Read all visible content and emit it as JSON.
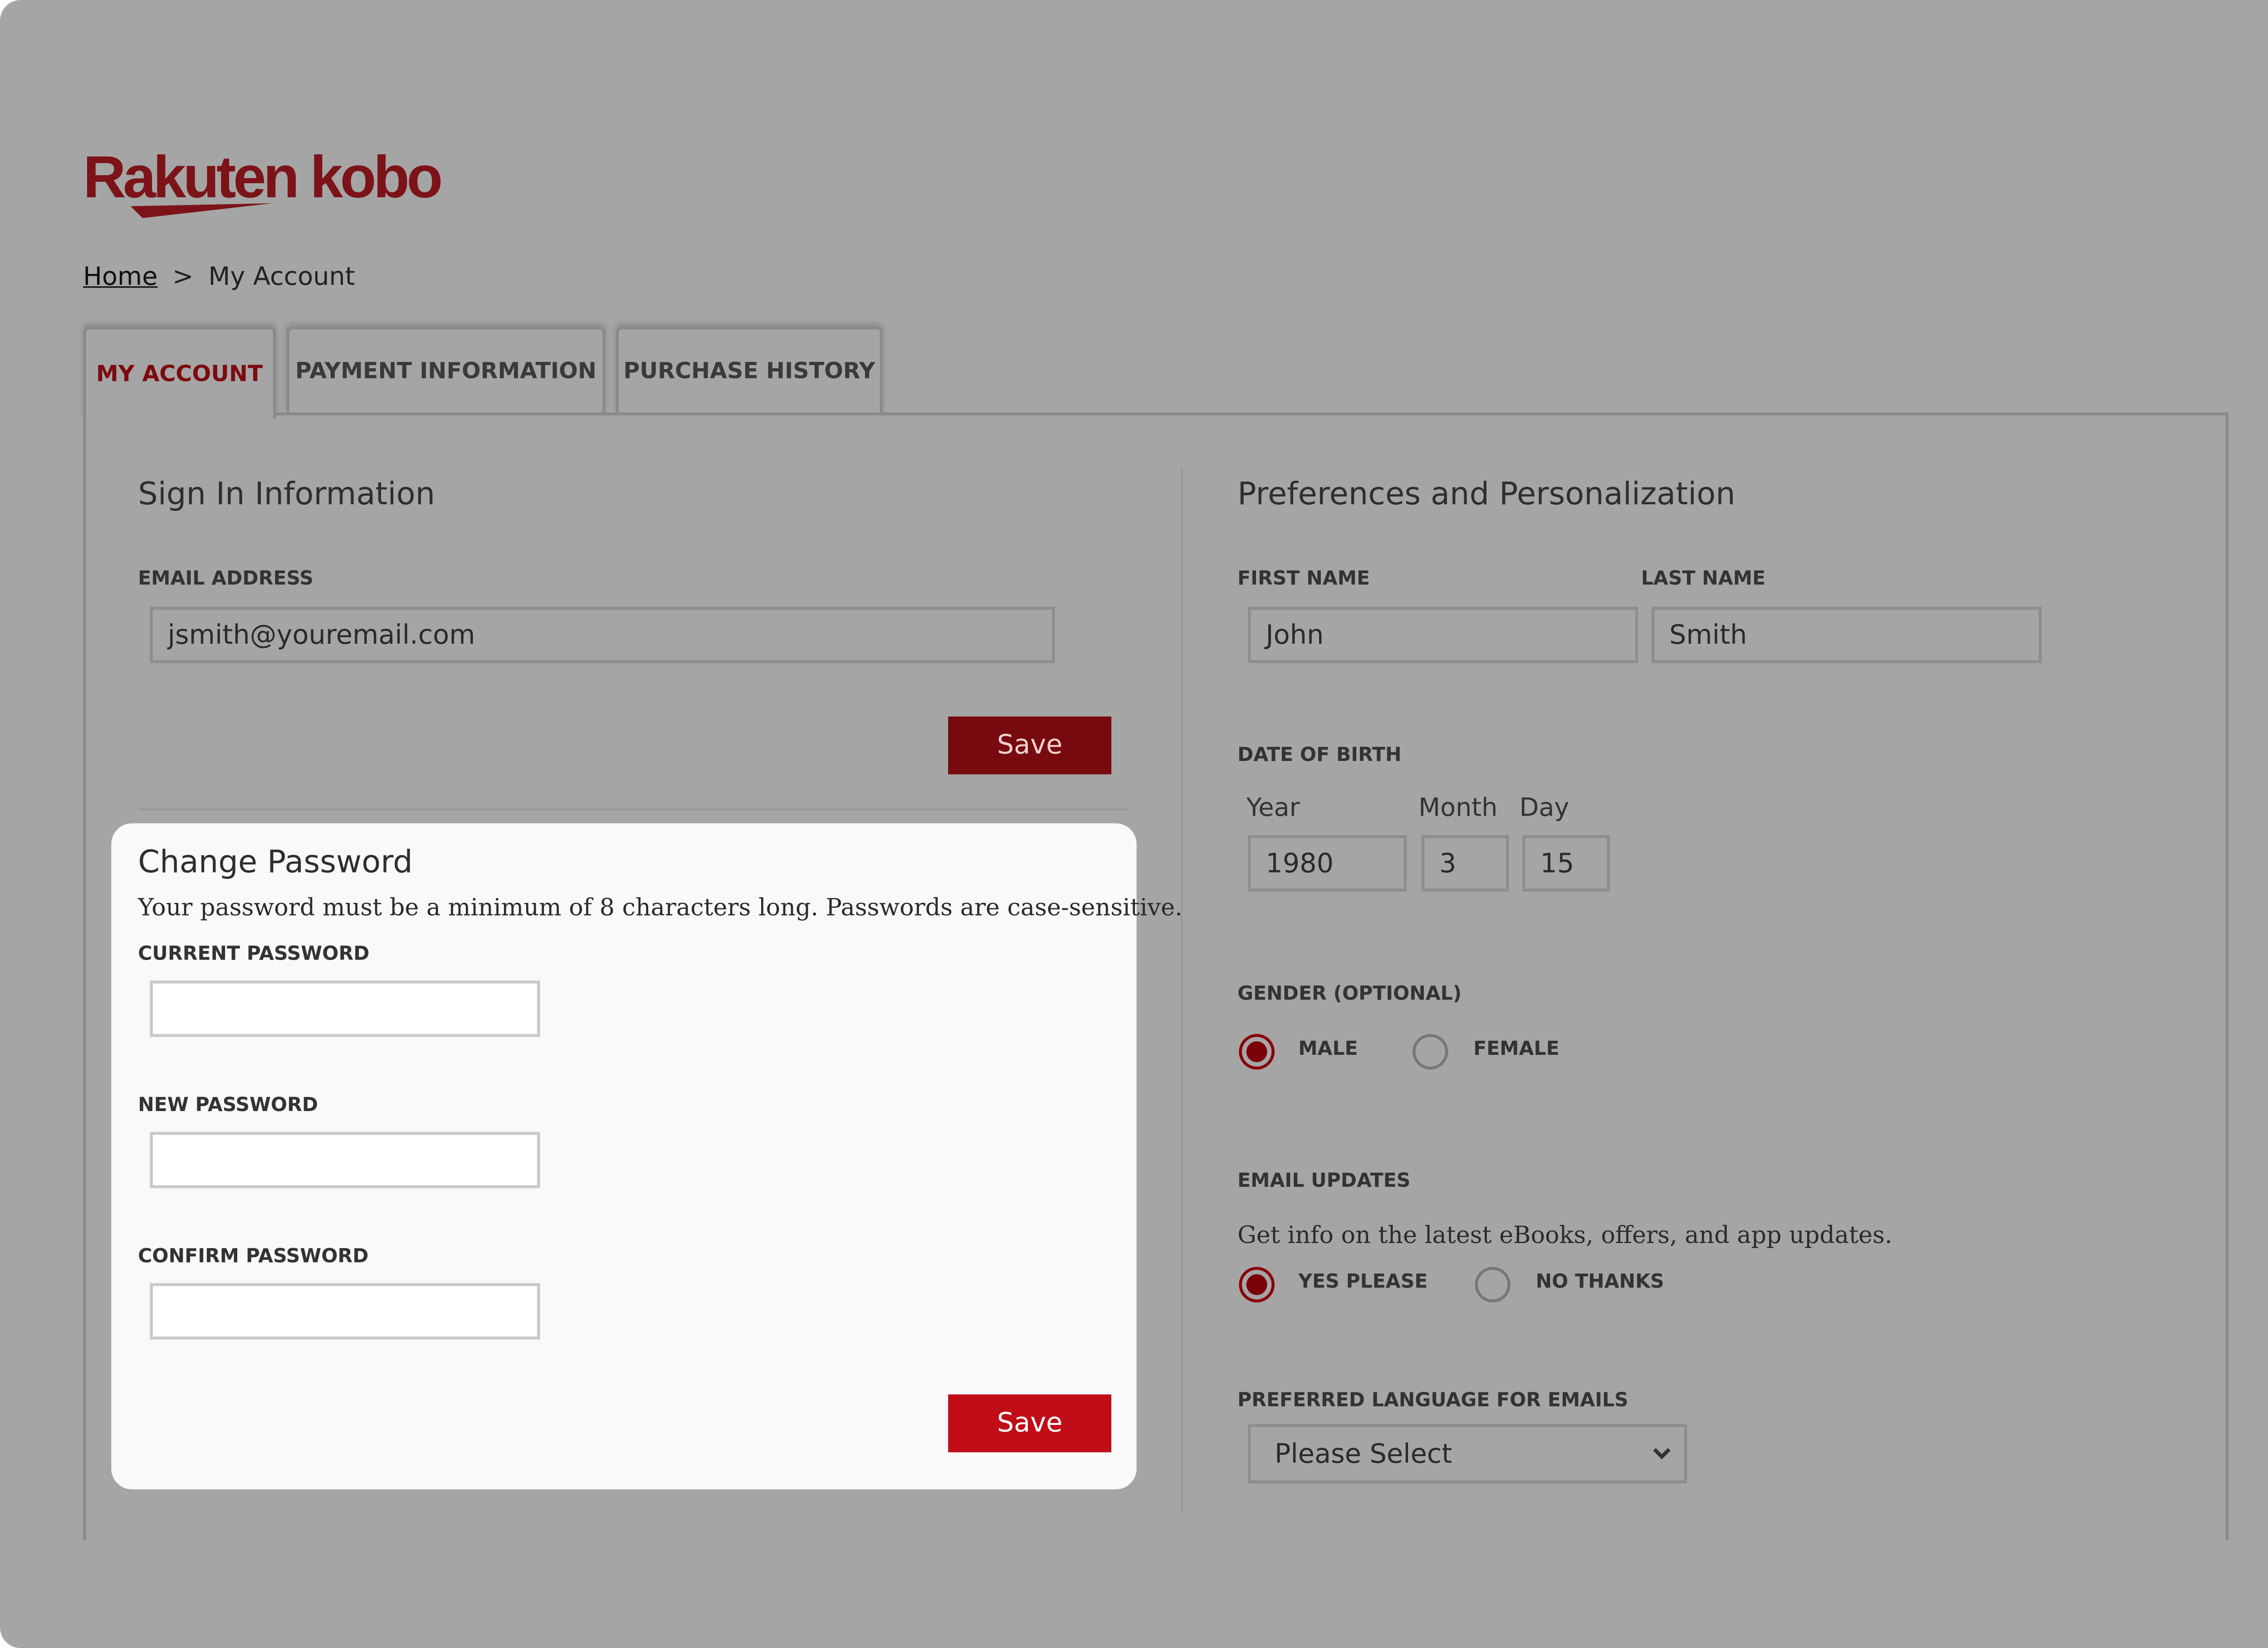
{
  "brand": {
    "logo_text": "Rakuten kobo",
    "accent_color": "#bf0013"
  },
  "breadcrumb": {
    "home": "Home",
    "separator": ">",
    "current": "My Account"
  },
  "tabs": [
    {
      "label": "MY ACCOUNT",
      "active": true
    },
    {
      "label": "PAYMENT INFORMATION",
      "active": false
    },
    {
      "label": "PURCHASE HISTORY",
      "active": false
    }
  ],
  "sign_in": {
    "title": "Sign In Information",
    "email_label": "EMAIL ADDRESS",
    "email_value": "jsmith@youremail.com",
    "save_label": "Save"
  },
  "change_password": {
    "title": "Change Password",
    "note": "Your password must be a minimum of 8 characters long. Passwords are case-sensitive.",
    "current_label": "CURRENT PASSWORD",
    "new_label": "NEW PASSWORD",
    "confirm_label": "CONFIRM PASSWORD",
    "current_value": "",
    "new_value": "",
    "confirm_value": "",
    "save_label": "Save"
  },
  "preferences": {
    "title": "Preferences and Personalization",
    "first_name_label": "FIRST NAME",
    "first_name": "John",
    "last_name_label": "LAST NAME",
    "last_name": "Smith",
    "dob_label": "DATE OF BIRTH",
    "year_label": "Year",
    "month_label": "Month",
    "day_label": "Day",
    "year": "1980",
    "month": "3",
    "day": "15",
    "gender_label": "GENDER (OPTIONAL)",
    "gender_options": [
      "MALE",
      "FEMALE"
    ],
    "gender_selected": "MALE",
    "email_updates_label": "EMAIL UPDATES",
    "email_updates_desc": "Get info on the latest eBooks, offers, and app updates.",
    "email_updates_options": [
      "YES PLEASE",
      "NO THANKS"
    ],
    "email_updates_selected": "YES PLEASE",
    "language_label": "PREFERRED LANGUAGE FOR EMAILS",
    "language_value": "Please Select"
  }
}
